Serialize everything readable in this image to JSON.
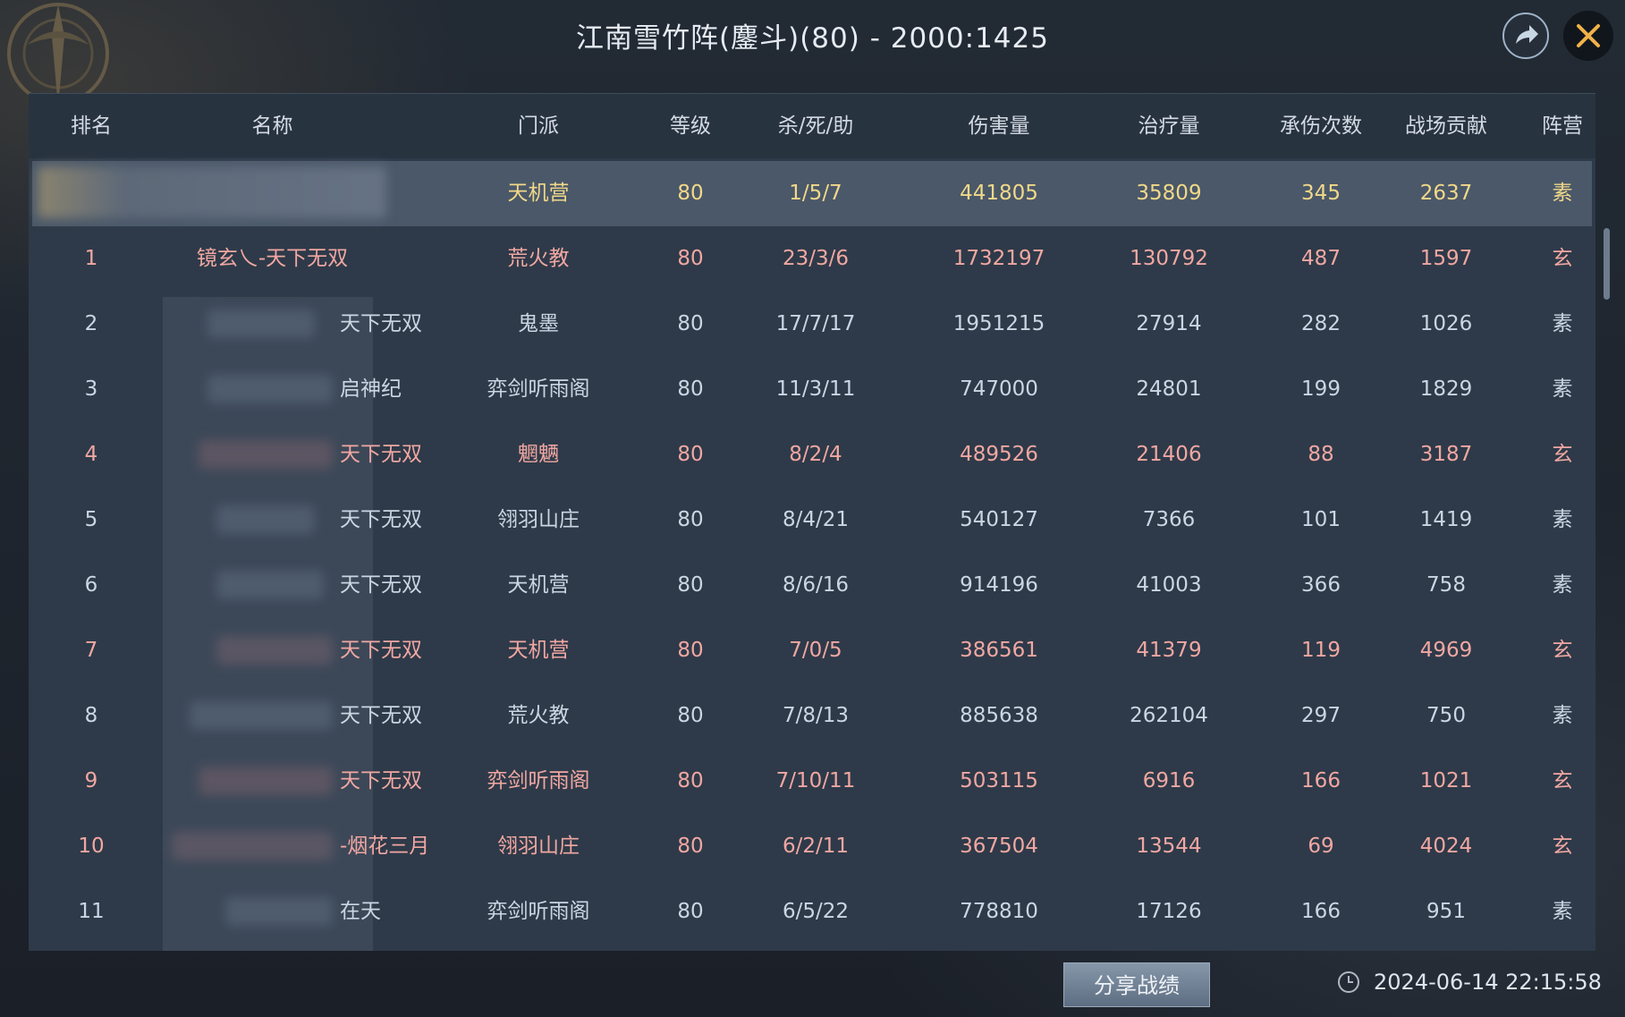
{
  "header": {
    "title": "江南雪竹阵(鏖斗)(80) - 2000:1425"
  },
  "table": {
    "columns": [
      "排名",
      "名称",
      "门派",
      "等级",
      "杀/死/助",
      "伤害量",
      "治疗量",
      "承伤次数",
      "战场贡献",
      "阵营"
    ],
    "self_row": {
      "rank": "",
      "name": "",
      "sect": "天机营",
      "level": "80",
      "kda": "1/5/7",
      "damage": "441805",
      "healing": "35809",
      "hits_taken": "345",
      "contribution": "2637",
      "camp": "素"
    },
    "rows": [
      {
        "rank": "1",
        "name": "镜玄乀-天下无双",
        "sect": "荒火教",
        "level": "80",
        "kda": "23/3/6",
        "damage": "1732197",
        "healing": "130792",
        "hits_taken": "487",
        "contribution": "1597",
        "camp": "玄"
      },
      {
        "rank": "2",
        "name": "天下无双",
        "sect": "鬼墨",
        "level": "80",
        "kda": "17/7/17",
        "damage": "1951215",
        "healing": "27914",
        "hits_taken": "282",
        "contribution": "1026",
        "camp": "素"
      },
      {
        "rank": "3",
        "name": "启神纪",
        "sect": "弈剑听雨阁",
        "level": "80",
        "kda": "11/3/11",
        "damage": "747000",
        "healing": "24801",
        "hits_taken": "199",
        "contribution": "1829",
        "camp": "素"
      },
      {
        "rank": "4",
        "name": "天下无双",
        "sect": "魍魉",
        "level": "80",
        "kda": "8/2/4",
        "damage": "489526",
        "healing": "21406",
        "hits_taken": "88",
        "contribution": "3187",
        "camp": "玄"
      },
      {
        "rank": "5",
        "name": "天下无双",
        "sect": "翎羽山庄",
        "level": "80",
        "kda": "8/4/21",
        "damage": "540127",
        "healing": "7366",
        "hits_taken": "101",
        "contribution": "1419",
        "camp": "素"
      },
      {
        "rank": "6",
        "name": "天下无双",
        "sect": "天机营",
        "level": "80",
        "kda": "8/6/16",
        "damage": "914196",
        "healing": "41003",
        "hits_taken": "366",
        "contribution": "758",
        "camp": "素"
      },
      {
        "rank": "7",
        "name": "天下无双",
        "sect": "天机营",
        "level": "80",
        "kda": "7/0/5",
        "damage": "386561",
        "healing": "41379",
        "hits_taken": "119",
        "contribution": "4969",
        "camp": "玄"
      },
      {
        "rank": "8",
        "name": "天下无双",
        "sect": "荒火教",
        "level": "80",
        "kda": "7/8/13",
        "damage": "885638",
        "healing": "262104",
        "hits_taken": "297",
        "contribution": "750",
        "camp": "素"
      },
      {
        "rank": "9",
        "name": "天下无双",
        "sect": "弈剑听雨阁",
        "level": "80",
        "kda": "7/10/11",
        "damage": "503115",
        "healing": "6916",
        "hits_taken": "166",
        "contribution": "1021",
        "camp": "玄"
      },
      {
        "rank": "10",
        "name": "-烟花三月",
        "sect": "翎羽山庄",
        "level": "80",
        "kda": "6/2/11",
        "damage": "367504",
        "healing": "13544",
        "hits_taken": "69",
        "contribution": "4024",
        "camp": "玄"
      },
      {
        "rank": "11",
        "name": "在天",
        "sect": "弈剑听雨阁",
        "level": "80",
        "kda": "6/5/22",
        "damage": "778810",
        "healing": "17126",
        "hits_taken": "166",
        "contribution": "951",
        "camp": "素"
      }
    ]
  },
  "footer": {
    "share_label": "分享战绩",
    "timestamp": "2024-06-14 22:15:58"
  },
  "icons": {
    "share": "share-icon",
    "close": "close-icon",
    "clock": "clock-icon"
  },
  "colors": {
    "self_text": "#f1d889",
    "xuan_text": "#f1a7a2",
    "su_text": "#cbd6e3",
    "close_x": "#f0b24a"
  }
}
